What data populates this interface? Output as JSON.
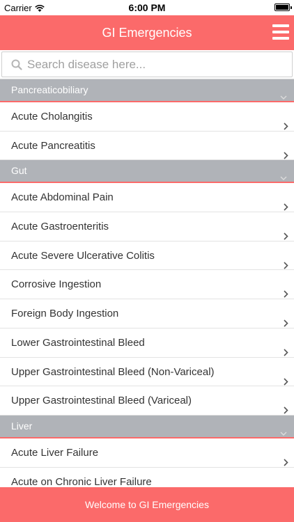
{
  "status_bar": {
    "carrier": "Carrier",
    "time": "6:00 PM"
  },
  "header": {
    "title": "GI Emergencies",
    "menu_icon": "hamburger-menu-icon"
  },
  "search": {
    "placeholder": "Search disease here...",
    "value": "",
    "icon": "search-icon"
  },
  "sections": [
    {
      "title": "Pancreaticobiliary",
      "items": [
        "Acute Cholangitis",
        "Acute Pancreatitis"
      ]
    },
    {
      "title": "Gut",
      "items": [
        "Acute Abdominal Pain",
        "Acute Gastroenteritis",
        "Acute Severe Ulcerative Colitis",
        "Corrosive Ingestion",
        "Foreign Body Ingestion",
        "Lower Gastrointestinal Bleed",
        "Upper Gastrointestinal Bleed (Non-Variceal)",
        "Upper Gastrointestinal Bleed (Variceal)"
      ]
    },
    {
      "title": "Liver",
      "items": [
        "Acute Liver Failure",
        "Acute on Chronic Liver Failure"
      ]
    }
  ],
  "footer": {
    "text": "Welcome to GI Emergencies"
  },
  "colors": {
    "accent": "#fb6a6a",
    "section_bg": "#b0b3b8",
    "text": "#333333"
  }
}
